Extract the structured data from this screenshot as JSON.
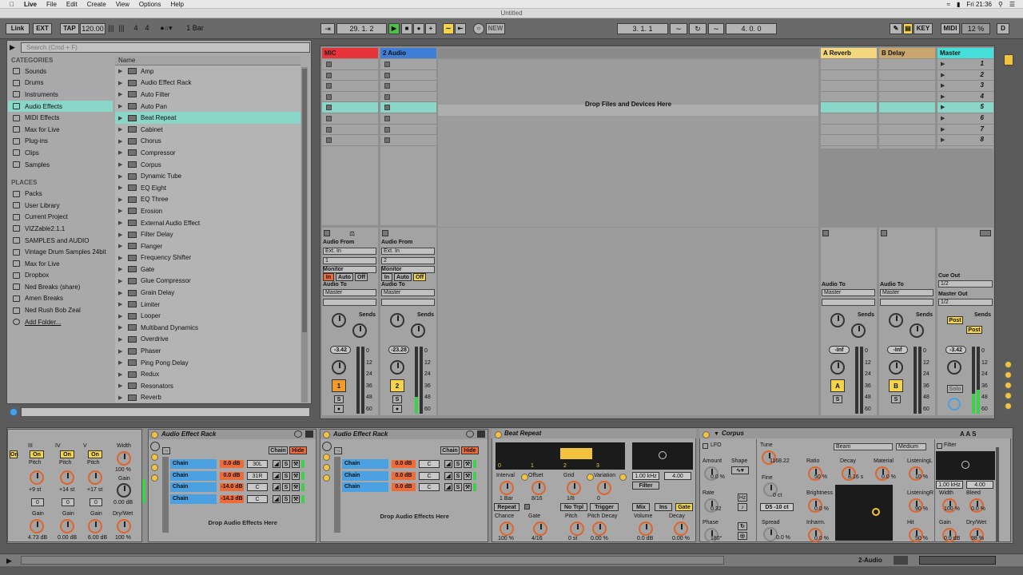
{
  "menubar": {
    "app": "Live",
    "items": [
      "File",
      "Edit",
      "Create",
      "View",
      "Options",
      "Help"
    ],
    "clock": "Fri 21:36"
  },
  "window": {
    "title": "Untitled"
  },
  "control_bar": {
    "link": "Link",
    "ext": "EXT",
    "tap": "TAP",
    "tempo": "120.00",
    "signature_num": "4",
    "signature_den": "4",
    "quantize": "1 Bar",
    "position": "29.   1.   2",
    "new": "NEW",
    "loop_start": "3.   1.   1",
    "loop_length": "4.   0.   0",
    "key": "KEY",
    "midi": "MIDI",
    "cpu": "12 %",
    "d": "D"
  },
  "browser": {
    "search_placeholder": "Search (Cmd + F)",
    "categories_title": "CATEGORIES",
    "categories": [
      {
        "label": "Sounds",
        "icon": "sounds-icon"
      },
      {
        "label": "Drums",
        "icon": "drums-icon"
      },
      {
        "label": "Instruments",
        "icon": "instruments-icon"
      },
      {
        "label": "Audio Effects",
        "icon": "audio-effects-icon",
        "selected": true
      },
      {
        "label": "MIDI Effects",
        "icon": "midi-effects-icon"
      },
      {
        "label": "Max for Live",
        "icon": "max-icon"
      },
      {
        "label": "Plug-ins",
        "icon": "plugins-icon"
      },
      {
        "label": "Clips",
        "icon": "clips-icon"
      },
      {
        "label": "Samples",
        "icon": "samples-icon"
      }
    ],
    "places_title": "PLACES",
    "places": [
      "Packs",
      "User Library",
      "Current Project",
      "VIZZable2.1.1",
      "SAMPLES and AUDIO",
      "Vintage Drum Samples 24bit",
      "Max for Live",
      "Dropbox",
      "Ned Breaks (share)",
      "Amen Breaks",
      "Ned Rush Bob Zeal",
      "Add Folder..."
    ],
    "name_header": "Name",
    "items": [
      "Amp",
      "Audio Effect Rack",
      "Auto Filter",
      "Auto Pan",
      "Beat Repeat",
      "Cabinet",
      "Chorus",
      "Compressor",
      "Corpus",
      "Dynamic Tube",
      "EQ Eight",
      "EQ Three",
      "Erosion",
      "External Audio Effect",
      "Filter Delay",
      "Flanger",
      "Frequency Shifter",
      "Gate",
      "Glue Compressor",
      "Grain Delay",
      "Limiter",
      "Looper",
      "Multiband Dynamics",
      "Overdrive",
      "Phaser",
      "Ping Pong Delay",
      "Redux",
      "Resonators",
      "Reverb"
    ],
    "selected_item": "Beat Repeat"
  },
  "session": {
    "tracks": [
      {
        "name": "MIC",
        "color": "#e8333a"
      },
      {
        "name": "2 Audio",
        "color": "#3e7ed6"
      }
    ],
    "returns": [
      {
        "name": "A Reverb",
        "color": "#f2d77f"
      },
      {
        "name": "B Delay",
        "color": "#c9a66b"
      }
    ],
    "master": {
      "name": "Master",
      "color": "#45e0da"
    },
    "drop_text": "Drop Files and Devices Here",
    "scenes": [
      "1",
      "2",
      "3",
      "4",
      "5",
      "6",
      "7",
      "8"
    ],
    "io": {
      "audio_from": "Audio From",
      "ext_in": "Ext. In",
      "in1": "1",
      "in2": "2",
      "monitor": "Monitor",
      "in": "In",
      "auto": "Auto",
      "off": "Off",
      "audio_to": "Audio To",
      "master": "Master",
      "cue_out": "Cue Out",
      "cue_val": "1/2",
      "master_out": "Master Out",
      "master_out_val": "1/2"
    },
    "sends": "Sends",
    "post": "Post",
    "volumes": [
      "-3.42",
      "-23.28",
      "-Inf",
      "-Inf",
      "-3.42"
    ],
    "scale": [
      "0",
      "12",
      "24",
      "36",
      "48",
      "60"
    ],
    "track_numbers": [
      "1",
      "2"
    ],
    "return_letters": [
      "A",
      "B"
    ],
    "solo": "S",
    "solo_full": "Solo"
  },
  "devices": {
    "left_partial": {
      "labels": [
        "III",
        "IV",
        "V",
        "Width"
      ],
      "on": "On",
      "pitch": "Pitch",
      "gain": "Gain",
      "drywet": "Dry/Wet",
      "values": [
        "+9 st",
        "+14 st",
        "+17 st",
        "100 %",
        "0.00 dB",
        "4.73 dB",
        "0.00 dB",
        "6.00 dB",
        "100 %"
      ],
      "zeros": [
        "0",
        "0",
        "0"
      ]
    },
    "rack1": {
      "title": "Audio Effect Rack",
      "chain_btn": "Chain",
      "hide_btn": "Hide",
      "chains": [
        {
          "name": "Chain",
          "gain": "0.0 dB",
          "pan": "30L"
        },
        {
          "name": "Chain",
          "gain": "0.0 dB",
          "pan": "31R"
        },
        {
          "name": "Chain",
          "gain": "-14.0 dB",
          "pan": "C"
        },
        {
          "name": "Chain",
          "gain": "-14.3 dB",
          "pan": "C"
        }
      ],
      "drop": "Drop Audio Effects Here"
    },
    "rack2": {
      "title": "Audio Effect Rack",
      "chain_btn": "Chain",
      "hide_btn": "Hide",
      "chains": [
        {
          "name": "Chain",
          "gain": "0.0 dB",
          "pan": "C"
        },
        {
          "name": "Chain",
          "gain": "0.0 dB",
          "pan": "C"
        },
        {
          "name": "Chain",
          "gain": "0.0 dB",
          "pan": "C"
        }
      ],
      "drop": "Drop Audio Effects Here"
    },
    "beat_repeat": {
      "title": "Beat Repeat",
      "grid_nums": [
        "0",
        "1",
        "2",
        "3"
      ],
      "filter_freq": "1.00 kHz",
      "filter_width": "4.00",
      "filter": "Filter",
      "interval": "Interval",
      "interval_v": "1 Bar",
      "offset": "Offset",
      "offset_v": "8/16",
      "grid": "Grid",
      "grid_v": "1/8",
      "variation": "Variation",
      "variation_v": "0",
      "repeat": "Repeat",
      "no_trpl": "No Trpl",
      "trigger": "Trigger",
      "mix": "Mix",
      "ins": "Ins",
      "gate": "Gate",
      "chance": "Chance",
      "chance_v": "100 %",
      "gate_l": "Gate",
      "gate_v": "4/16",
      "pitch": "Pitch",
      "pitch_v": "0 st",
      "pitch_decay": "Pitch Decay",
      "pitch_decay_v": "0.00 %",
      "volume": "Volume",
      "volume_v": "0.0 dB",
      "decay": "Decay",
      "decay_v": "0.00 %"
    },
    "corpus": {
      "title": "Corpus",
      "lfo": "LFO",
      "amount": "Amount",
      "amount_v": "0.0 %",
      "shape": "Shape",
      "rate": "Rate",
      "rate_v": "0.32",
      "hz": "Hz",
      "phase": "Phase",
      "phase_v": "180°",
      "tune": "Tune",
      "tune_v": "1168.22",
      "fine": "Fine",
      "fine_v": "0 ct",
      "note": "D5  -10 ct",
      "spread": "Spread",
      "spread_v": "0.0 %",
      "type": "Beam",
      "quality": "Medium",
      "ratio": "Ratio",
      "ratio_v": "50 %",
      "decay": "Decay",
      "decay_v": "8.16 s",
      "material": "Material",
      "material_v": "0.0 %",
      "listeningL": "ListeningL",
      "listeningL_v": "10 %",
      "brightness": "Brightness",
      "brightness_v": "0.0 %",
      "listeningR": "ListeningR",
      "listeningR_v": "90 %",
      "inharm": "Inharm.",
      "inharm_v": "0.0 %",
      "hit": "Hit",
      "hit_v": "50 %",
      "filter": "Filter",
      "filter_freq": "1.00 kHz",
      "filter_width": "4.00",
      "width": "Width",
      "width_v": "100 %",
      "bleed": "Bleed",
      "bleed_v": "0.0 %",
      "gain": "Gain",
      "gain_v": "0.0 dB",
      "drywet": "Dry/Wet",
      "drywet_v": "98 %",
      "aas": "A A S"
    }
  },
  "status": {
    "track": "2-Audio"
  }
}
